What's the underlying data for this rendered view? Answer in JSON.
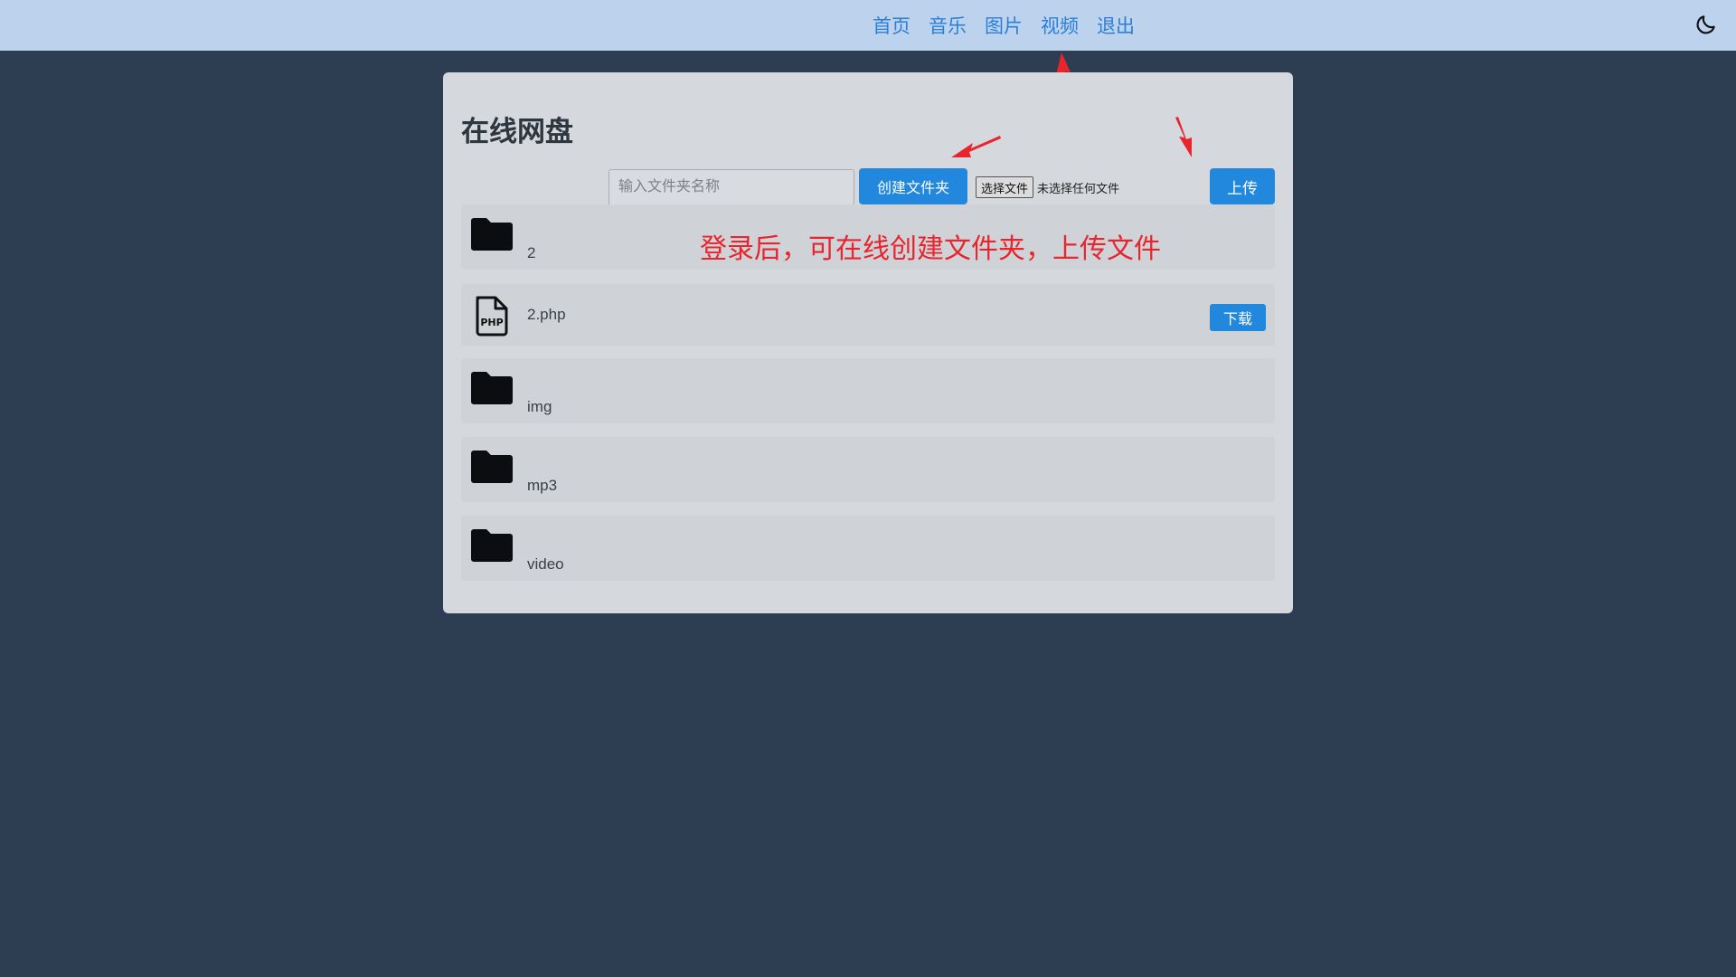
{
  "nav": {
    "items": [
      "首页",
      "音乐",
      "图片",
      "视频",
      "退出"
    ],
    "theme_icon": "moon-icon"
  },
  "panel": {
    "title": "在线网盘",
    "folder_name_placeholder": "输入文件夹名称",
    "create_folder_label": "创建文件夹",
    "choose_file_label": "选择文件",
    "no_file_selected": "未选择任何文件",
    "upload_label": "上传"
  },
  "files": [
    {
      "name": "2",
      "type": "folder",
      "icon": "folder-icon"
    },
    {
      "name": "2.php",
      "type": "file",
      "icon": "php-file-icon",
      "action": "下载"
    },
    {
      "name": "img",
      "type": "folder",
      "icon": "folder-icon"
    },
    {
      "name": "mp3",
      "type": "folder",
      "icon": "folder-icon"
    },
    {
      "name": "video",
      "type": "folder",
      "icon": "folder-icon"
    }
  ],
  "annotation": {
    "text": "登录后，可在线创建文件夹，上传文件",
    "color": "#e8242c"
  },
  "colors": {
    "accent": "#2288dd",
    "nav_link": "#2b7fd6",
    "background": "#2e3e52",
    "topbar": "#bdd3ed",
    "panel": "#d5d8dd"
  }
}
